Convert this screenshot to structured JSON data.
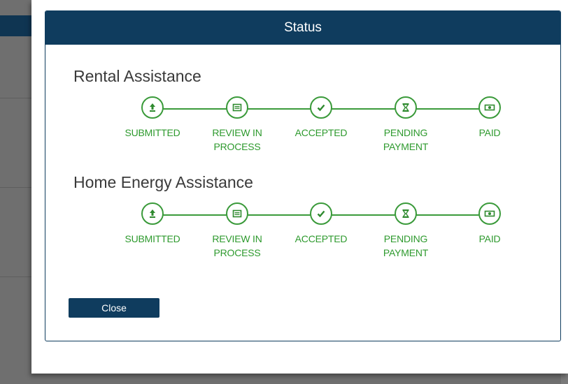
{
  "modal": {
    "title": "Status",
    "close_label": "Close"
  },
  "programs": [
    {
      "name": "Rental Assistance",
      "steps": [
        {
          "label": "SUBMITTED",
          "icon": "upload-icon"
        },
        {
          "label": "REVIEW IN\nPROCESS",
          "icon": "document-icon"
        },
        {
          "label": "ACCEPTED",
          "icon": "checkmark-icon"
        },
        {
          "label": "PENDING\nPAYMENT",
          "icon": "hourglass-icon"
        },
        {
          "label": "PAID",
          "icon": "money-icon"
        }
      ]
    },
    {
      "name": "Home Energy Assistance",
      "steps": [
        {
          "label": "SUBMITTED",
          "icon": "upload-icon"
        },
        {
          "label": "REVIEW IN\nPROCESS",
          "icon": "document-icon"
        },
        {
          "label": "ACCEPTED",
          "icon": "checkmark-icon"
        },
        {
          "label": "PENDING\nPAYMENT",
          "icon": "hourglass-icon"
        },
        {
          "label": "PAID",
          "icon": "money-icon"
        }
      ]
    }
  ],
  "colors": {
    "header": "#0f3c5e",
    "progress_green": "#3a9a3a"
  }
}
